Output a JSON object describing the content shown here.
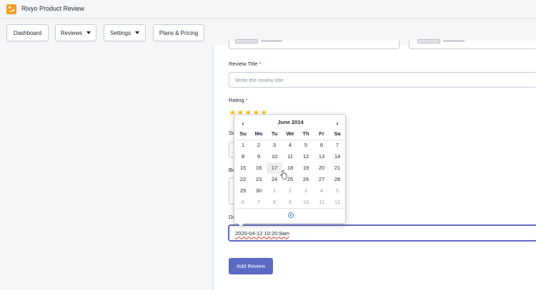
{
  "app": {
    "title": "Rivyo Product Review"
  },
  "nav": [
    {
      "label": "Dashboard",
      "dropdown": false
    },
    {
      "label": "Reviews",
      "dropdown": true
    },
    {
      "label": "Settings",
      "dropdown": true
    },
    {
      "label": "Plans & Pricing",
      "dropdown": false
    }
  ],
  "form": {
    "review_title_label": "Review Title",
    "review_title_placeholder": "Write the review title",
    "rating_label": "Rating",
    "rating_value": 5,
    "required_mark": "*",
    "partial_label_1": "Se",
    "partial_label_2": "Bo",
    "partial_label_3": "Da",
    "date_value": "2020-04-12 10:20:9am",
    "submit_label": "Add Review"
  },
  "datepicker": {
    "month_title": "June 2014",
    "prev": "‹",
    "next": "›",
    "weekdays": [
      "Su",
      "Mo",
      "Tu",
      "We",
      "Th",
      "Fr",
      "Sa"
    ],
    "weeks": [
      [
        "1",
        "2",
        "3",
        "4",
        "5",
        "6",
        "7"
      ],
      [
        "8",
        "9",
        "10",
        "11",
        "12",
        "13",
        "14"
      ],
      [
        "15",
        "16",
        "17",
        "18",
        "19",
        "20",
        "21"
      ],
      [
        "22",
        "23",
        "24",
        "25",
        "26",
        "27",
        "28"
      ],
      [
        "29",
        "30",
        "1",
        "2",
        "3",
        "4",
        "5"
      ],
      [
        "6",
        "7",
        "8",
        "9",
        "10",
        "11",
        "12"
      ]
    ],
    "highlighted_day": "17",
    "icons": [
      "chevron-left-icon",
      "chevron-right-icon",
      "clock-icon"
    ]
  },
  "colors": {
    "accent": "#5c6ac4",
    "star": "#f5c023",
    "logo": "#f59d22",
    "required": "#de3618"
  }
}
